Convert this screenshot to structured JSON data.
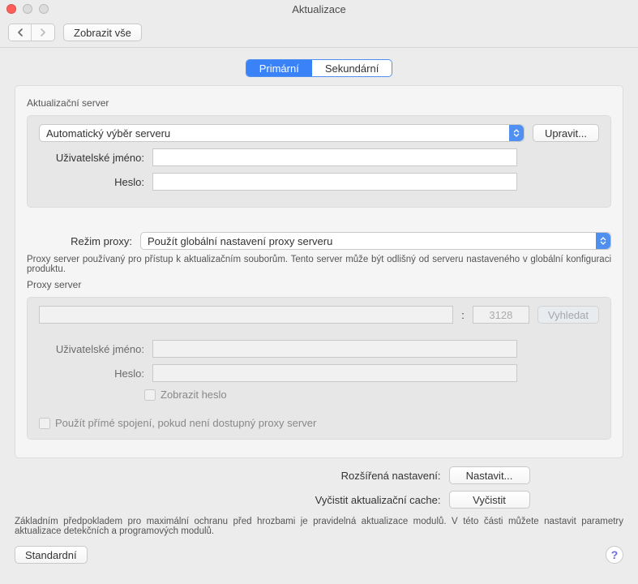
{
  "window": {
    "title": "Aktualizace"
  },
  "toolbar": {
    "show_all": "Zobrazit vše"
  },
  "tabs": {
    "primary": "Primární",
    "secondary": "Sekundární"
  },
  "update_server": {
    "section_label": "Aktualizační server",
    "server_select": "Automatický výběr serveru",
    "edit_btn": "Upravit...",
    "user_label": "Uživatelské jméno:",
    "user_value": "",
    "pass_label": "Heslo:",
    "pass_value": ""
  },
  "proxy_mode": {
    "label": "Režim proxy:",
    "value": "Použít globální nastavení proxy serveru",
    "note": "Proxy server používaný pro přístup k aktualizačním souborům. Tento server může být odlišný od serveru nastaveného v globální konfiguraci produktu."
  },
  "proxy_server": {
    "section_label": "Proxy server",
    "host_value": "",
    "port_value": "3128",
    "port_sep": ":",
    "find_btn": "Vyhledat",
    "user_label": "Uživatelské jméno:",
    "user_value": "",
    "pass_label": "Heslo:",
    "pass_value": "",
    "show_pass_label": "Zobrazit heslo",
    "direct_conn_label": "Použít přímé spojení, pokud není dostupný proxy server"
  },
  "advanced": {
    "settings_label": "Rozšířená nastavení:",
    "settings_btn": "Nastavit...",
    "clear_label": "Vyčistit aktualizační cache:",
    "clear_btn": "Vyčistit"
  },
  "footer": {
    "note": "Základním předpokladem pro maximální ochranu před hrozbami je pravidelná aktualizace modulů. V této části můžete nastavit parametry aktualizace detekčních a programových modulů.",
    "default_btn": "Standardní",
    "help": "?"
  }
}
